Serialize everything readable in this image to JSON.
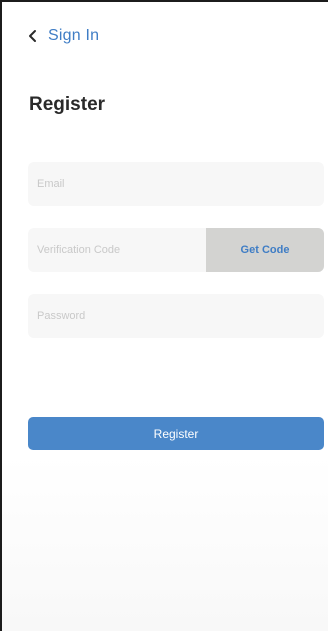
{
  "nav": {
    "back_label": "Sign In",
    "back_icon": "chevron-left-icon"
  },
  "page": {
    "title": "Register"
  },
  "form": {
    "email": {
      "placeholder": "Email",
      "value": ""
    },
    "verification_code": {
      "placeholder": "Verification Code",
      "value": ""
    },
    "get_code_label": "Get Code",
    "password": {
      "placeholder": "Password",
      "value": ""
    },
    "submit_label": "Register"
  },
  "colors": {
    "accent": "#3f7dc5",
    "button": "#4a87c9",
    "get_code_bg": "#d3d3d1",
    "field_bg": "#f7f7f7"
  }
}
